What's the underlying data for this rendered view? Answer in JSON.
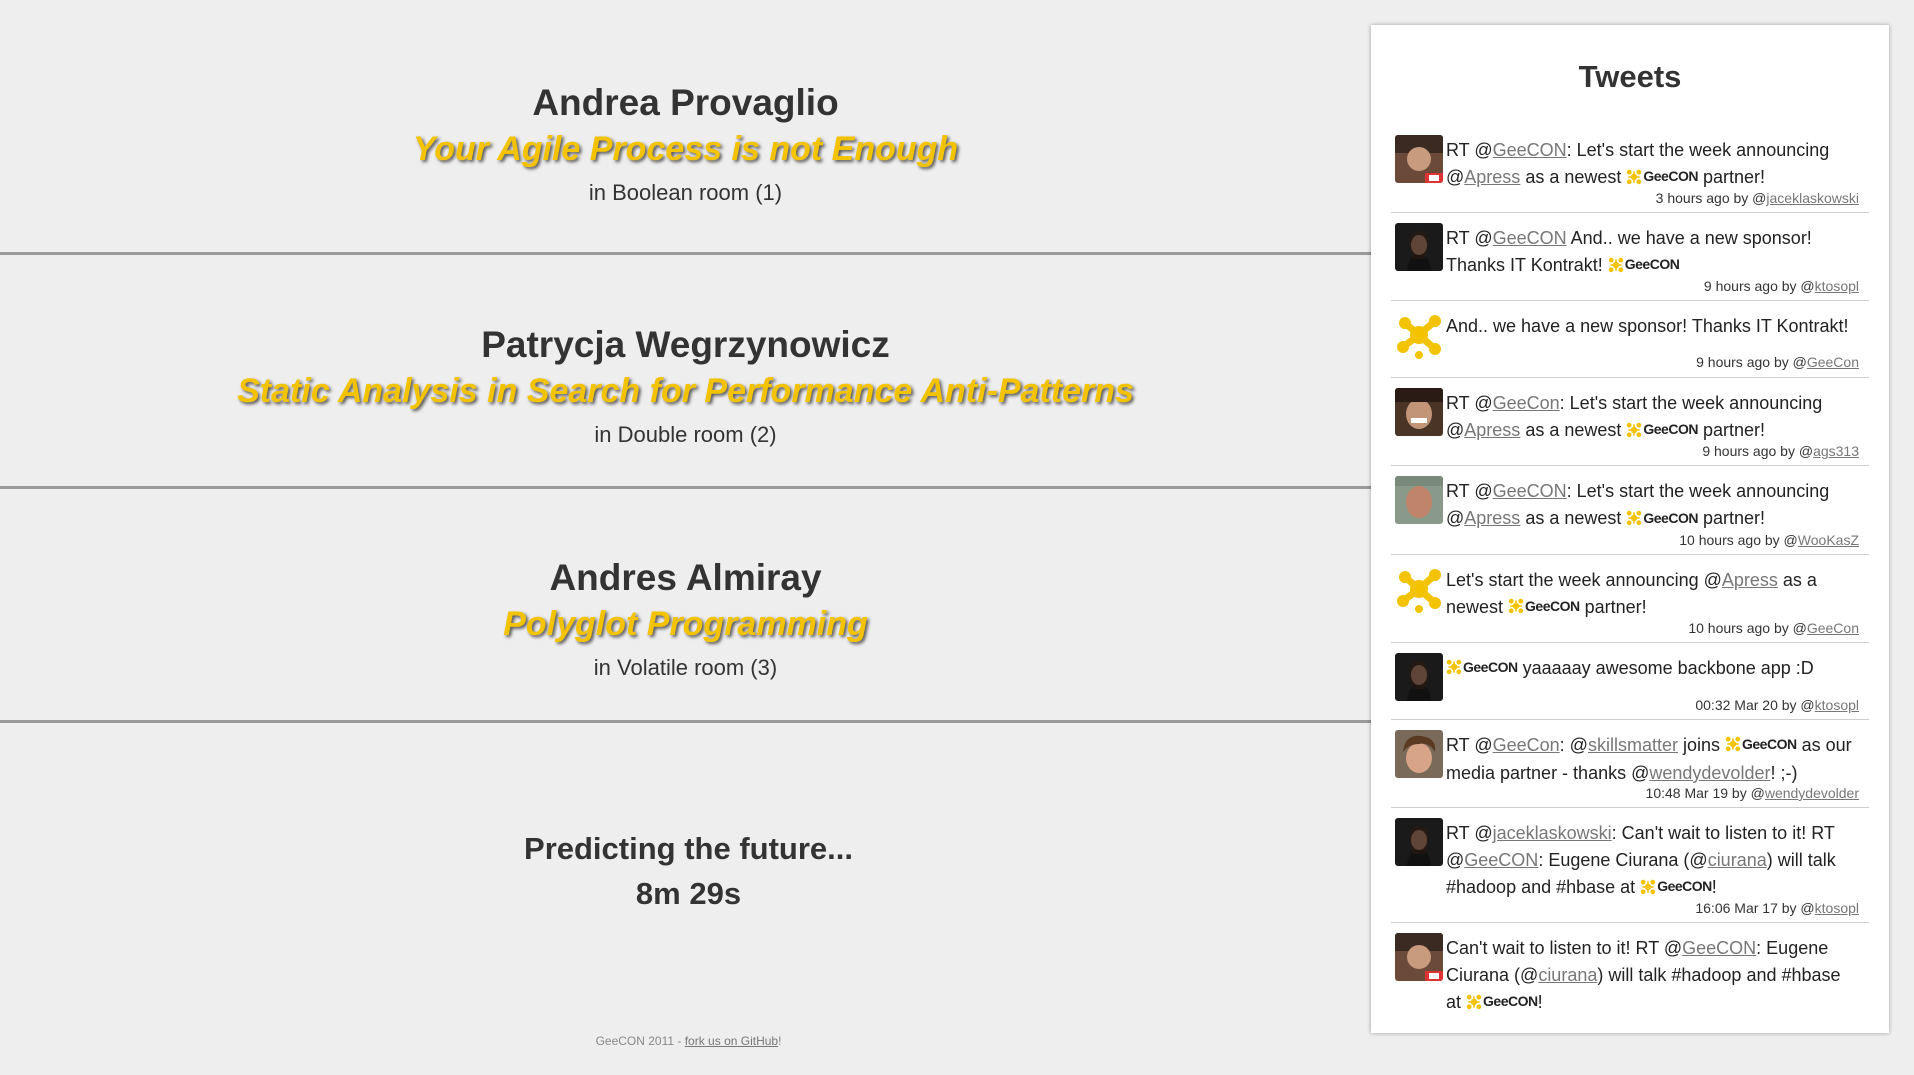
{
  "talks": [
    {
      "speaker": "Andrea Provaglio",
      "title": "Your Agile Process is not Enough",
      "room": "in Boolean room (1)"
    },
    {
      "speaker": "Patrycja Wegrzynowicz",
      "title": "Static Analysis in Search for Performance Anti-Patterns",
      "room": "in Double room (2)"
    },
    {
      "speaker": "Andres Almiray",
      "title": "Polyglot Programming",
      "room": "in Volatile room (3)"
    }
  ],
  "prediction": {
    "line1": "Predicting the future...",
    "line2": "8m 29s"
  },
  "footer": {
    "prefix": "GeeCON 2011 - ",
    "link": "fork us on GitHub",
    "suffix": "!"
  },
  "tweets": {
    "heading": "Tweets",
    "logo_text": "GeeCON",
    "colors": {
      "accent": "#f4c300",
      "link": "#777777"
    },
    "items": [
      {
        "avatar": "avatar-photo",
        "meta_time": "3 hours ago by @",
        "meta_user": "jaceklaskowski",
        "parts": {
          "a": "RT @",
          "b": "GeeCON",
          "c": ": Let's start the week announcing @",
          "d": "Apress",
          "e": " as a newest ",
          "f": " partner!"
        }
      },
      {
        "avatar": "avatar-photo",
        "meta_time": "9 hours ago by @",
        "meta_user": "ktosopl",
        "parts": {
          "a": "RT @",
          "b": "GeeCON",
          "c": " And.. we have a new sponsor! Thanks IT Kontrakt! "
        }
      },
      {
        "avatar": "geecon-logo-icon",
        "meta_time": "9 hours ago by @",
        "meta_user": "GeeCon",
        "parts": {
          "a": "And.. we have a new sponsor! Thanks IT Kontrakt!"
        }
      },
      {
        "avatar": "avatar-photo",
        "meta_time": "9 hours ago by @",
        "meta_user": "ags313",
        "parts": {
          "a": "RT @",
          "b": "GeeCon",
          "c": ": Let's start the week announcing @",
          "d": "Apress",
          "e": " as a newest ",
          "f": " partner!"
        }
      },
      {
        "avatar": "avatar-photo",
        "meta_time": "10 hours ago by @",
        "meta_user": "WooKasZ",
        "parts": {
          "a": "RT @",
          "b": "GeeCON",
          "c": ": Let's start the week announcing @",
          "d": "Apress",
          "e": " as a newest ",
          "f": " partner!"
        }
      },
      {
        "avatar": "geecon-logo-icon",
        "meta_time": "10 hours ago by @",
        "meta_user": "GeeCon",
        "parts": {
          "a": "Let's start the week announcing @",
          "b": "Apress",
          "c": " as a newest ",
          "d": " partner!"
        }
      },
      {
        "avatar": "avatar-photo",
        "meta_time": "00:32 Mar 20 by @",
        "meta_user": "ktosopl",
        "parts": {
          "a": " yaaaaay awesome backbone app :D"
        }
      },
      {
        "avatar": "avatar-photo",
        "meta_time": "10:48 Mar 19 by @",
        "meta_user": "wendydevolder",
        "parts": {
          "a": "RT @",
          "b": "GeeCon",
          "c": ": @",
          "d": "skillsmatter",
          "e": " joins ",
          "f": " as our media partner - thanks @",
          "g": "wendydevolder",
          "h": "! ;-)"
        }
      },
      {
        "avatar": "avatar-photo",
        "meta_time": "16:06 Mar 17 by @",
        "meta_user": "ktosopl",
        "parts": {
          "a": "RT @",
          "b": "jaceklaskowski",
          "c": ": Can't wait to listen to it! RT @",
          "d": "GeeCON",
          "e": ": Eugene Ciurana (@",
          "f": "ciurana",
          "g": ") will talk #hadoop and #hbase at ",
          "h": "!"
        }
      },
      {
        "avatar": "avatar-photo",
        "meta_time": "",
        "meta_user": "",
        "parts": {
          "a": "Can't wait to listen to it! RT @",
          "b": "GeeCON",
          "c": ": Eugene Ciurana (@",
          "d": "ciurana",
          "e": ") will talk #hadoop and #hbase at ",
          "f": "!"
        }
      }
    ]
  }
}
